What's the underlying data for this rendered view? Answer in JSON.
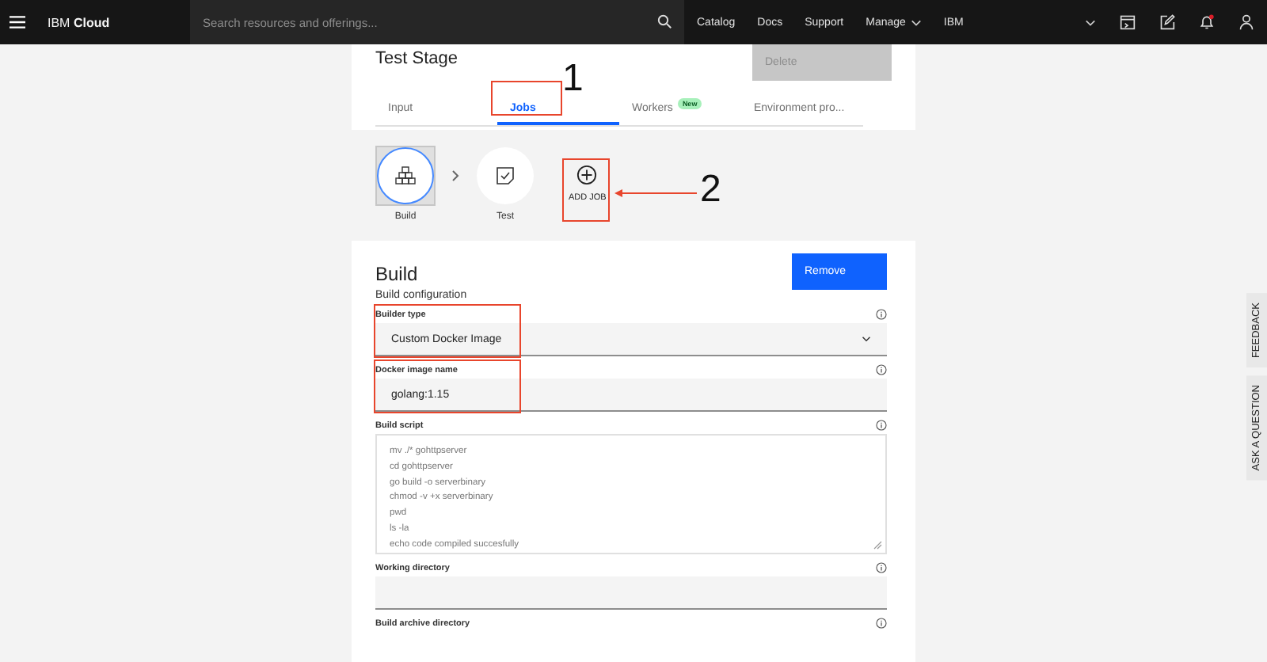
{
  "header": {
    "brand": "IBM **Cloud**",
    "search": {
      "placeholder": "Search resources and offerings..."
    },
    "nav": [
      {
        "label": "Catalog",
        "dropdown": false
      },
      {
        "label": "Docs",
        "dropdown": false
      },
      {
        "label": "Support",
        "dropdown": false
      },
      {
        "label": "Manage",
        "dropdown": true
      },
      {
        "label": "IBM",
        "dropdown": false
      }
    ],
    "notification_dot": true
  },
  "stage": {
    "title": "Test Stage",
    "delete_button": {
      "label": "Delete",
      "disabled": true
    },
    "tabs": [
      {
        "label": "Input",
        "selected": false,
        "highlighted": false
      },
      {
        "label": "Jobs",
        "selected": true,
        "highlighted": true
      },
      {
        "label": "Workers",
        "selected": false,
        "highlighted": false,
        "badge": "New"
      },
      {
        "label": "Environment pro...",
        "selected": false,
        "highlighted": false
      }
    ],
    "jobs": [
      {
        "label": "Build",
        "kind": "build",
        "selected": true
      },
      {
        "label": "Test",
        "kind": "test",
        "selected": false
      }
    ],
    "add_job": {
      "label": "ADD JOB",
      "highlighted": true
    }
  },
  "annotations": [
    {
      "label": "1"
    },
    {
      "label": "2"
    }
  ],
  "job_panel": {
    "title": "Build",
    "remove_button": "Remove",
    "section": "Build configuration",
    "fields": [
      {
        "kind": "select",
        "label": "Builder type",
        "value": "Custom Docker Image",
        "highlighted": true
      },
      {
        "kind": "text",
        "label": "Docker image name",
        "value": "golang:1.15",
        "highlighted": true
      },
      {
        "kind": "textarea",
        "label": "Build script",
        "value": "mv ./* gohttpserver\ncd gohttpserver\ngo build -o serverbinary\nchmod -v +x serverbinary\npwd\nls -la\necho code compiled succesfully",
        "highlighted": false
      },
      {
        "kind": "text",
        "label": "Working directory",
        "highlighted": false
      },
      {
        "kind": "cut",
        "label": "Build archive directory",
        "highlighted": false
      }
    ]
  },
  "side_tabs": [
    "FEEDBACK",
    "ASK A QUESTION"
  ]
}
